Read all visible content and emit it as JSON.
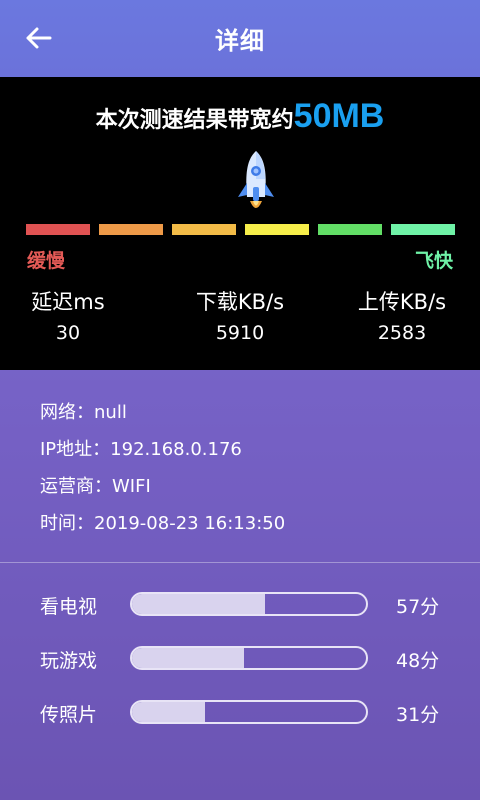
{
  "header": {
    "title": "详细",
    "back_icon": "arrow-left-icon"
  },
  "result": {
    "prefix": "本次测速结果带宽约",
    "value": "50MB"
  },
  "speed_scale": {
    "colors": [
      "#e05252",
      "#ee9a48",
      "#f2bb47",
      "#f6ee4a",
      "#62de66",
      "#6ff2a7"
    ],
    "slow_label": "缓慢",
    "fast_label": "飞快"
  },
  "metrics": {
    "latency": {
      "label": "延迟ms",
      "value": "30"
    },
    "download": {
      "label": "下载KB/s",
      "value": "5910"
    },
    "upload": {
      "label": "上传KB/s",
      "value": "2583"
    }
  },
  "info": {
    "network": "网络：null",
    "ip": "IP地址：192.168.0.176",
    "carrier": "运营商：WIFI",
    "time": "时间：2019-08-23 16:13:50"
  },
  "ratings": [
    {
      "label": "看电视",
      "score": "57分",
      "level": 0.57
    },
    {
      "label": "玩游戏",
      "score": "48分",
      "level": 0.48
    },
    {
      "label": "传照片",
      "score": "31分",
      "level": 0.31
    }
  ]
}
